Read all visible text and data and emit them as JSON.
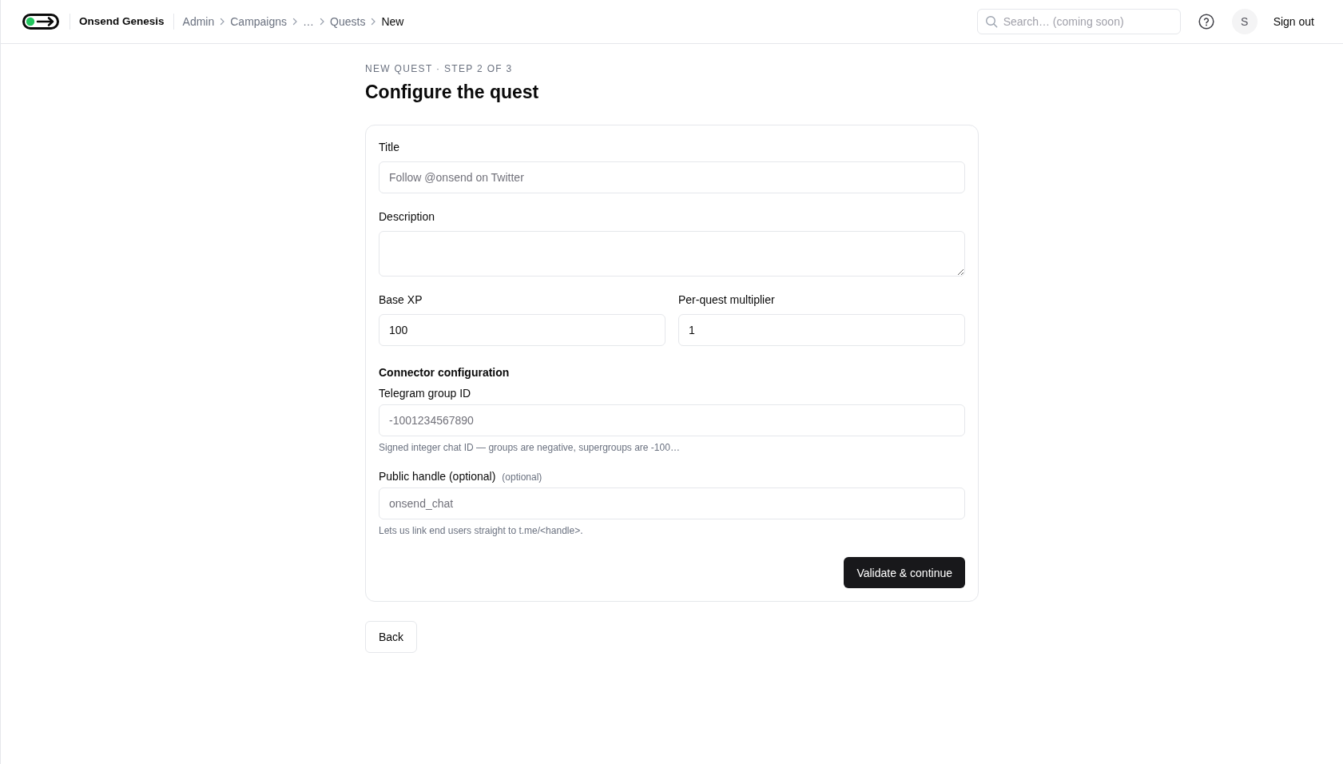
{
  "header": {
    "brand": "Onsend Genesis",
    "breadcrumbs": [
      {
        "label": "Admin",
        "current": false
      },
      {
        "label": "Campaigns",
        "current": false
      },
      {
        "label": "…",
        "current": false
      },
      {
        "label": "Quests",
        "current": false
      },
      {
        "label": "New",
        "current": true
      }
    ],
    "search": {
      "placeholder": "Search… (coming soon)"
    },
    "avatar": "S",
    "sign_out": "Sign out"
  },
  "page": {
    "eyebrow": "NEW QUEST · STEP 2 OF 3",
    "title": "Configure the quest"
  },
  "form": {
    "fields": [
      {
        "kind": "input",
        "label": "Title",
        "placeholder": "Follow @onsend on Twitter"
      },
      {
        "kind": "textarea",
        "label": "Description"
      },
      {
        "kind": "pair",
        "fields": [
          {
            "label": "Base XP",
            "value": "100"
          },
          {
            "label": "Per-quest multiplier",
            "value": "1"
          }
        ]
      }
    ],
    "connector": {
      "heading": "Connector configuration",
      "fields": [
        {
          "kind": "input",
          "label": "Telegram group ID",
          "placeholder": "-1001234567890",
          "hint": "Signed integer chat ID — groups are negative, supergroups are -100…"
        },
        {
          "kind": "input",
          "label": "Public handle (optional)",
          "note": "(optional)",
          "placeholder": "onsend_chat",
          "hint": "Lets us link end users straight to t.me/<handle>."
        }
      ]
    },
    "submit": "Validate & continue"
  },
  "back": "Back"
}
